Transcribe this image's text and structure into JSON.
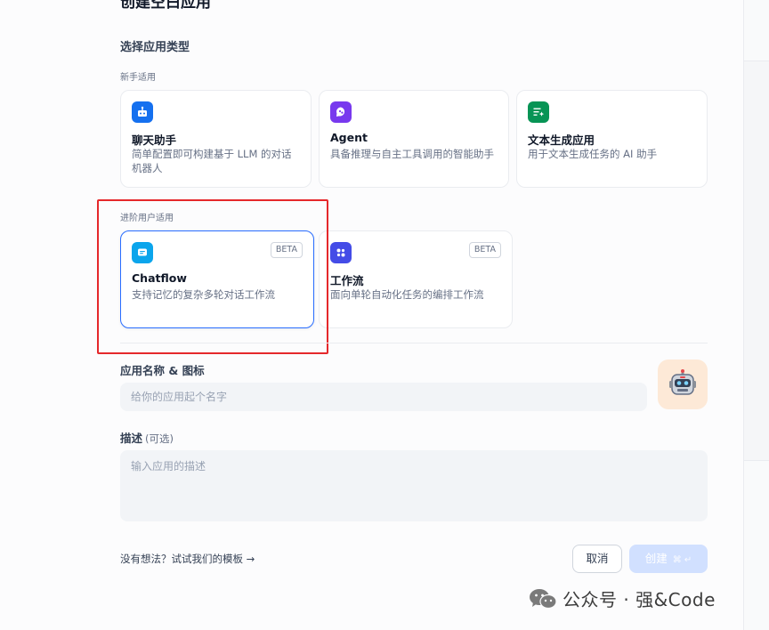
{
  "page": {
    "title": "创建空白应用",
    "section_title": "选择应用类型",
    "group_beginner": "新手适用",
    "group_advanced": "进阶用户适用"
  },
  "app_types": {
    "chatbot": {
      "title": "聊天助手",
      "desc": "简单配置即可构建基于 LLM 的对话机器人",
      "icon": "robot-icon",
      "color": "#1570ef"
    },
    "agent": {
      "title": "Agent",
      "desc": "具备推理与自主工具调用的智能助手",
      "icon": "brain-icon",
      "color": "#7839ee"
    },
    "textgen": {
      "title": "文本生成应用",
      "desc": "用于文本生成任务的 AI 助手",
      "icon": "text-sparkle-icon",
      "color": "#079455"
    },
    "chatflow": {
      "title": "Chatflow",
      "desc": "支持记忆的复杂多轮对话工作流",
      "badge": "BETA",
      "icon": "chat-bubble-icon",
      "color": "#0ba5ec",
      "selected": true
    },
    "workflow": {
      "title": "工作流",
      "desc": "面向单轮自动化任务的编排工作流",
      "badge": "BETA",
      "icon": "workflow-icon",
      "color": "#444ce7"
    }
  },
  "form": {
    "name_label": "应用名称 & 图标",
    "name_placeholder": "给你的应用起个名字",
    "desc_label": "描述",
    "desc_optional": "(可选)",
    "desc_placeholder": "输入应用的描述"
  },
  "footer": {
    "template_link": "没有想法？试试我们的模板",
    "template_arrow": "→",
    "cancel": "取消",
    "create": "创建",
    "create_shortcut": "⌘ ↵"
  },
  "watermark": {
    "text": "公众号 · 强&Code"
  }
}
